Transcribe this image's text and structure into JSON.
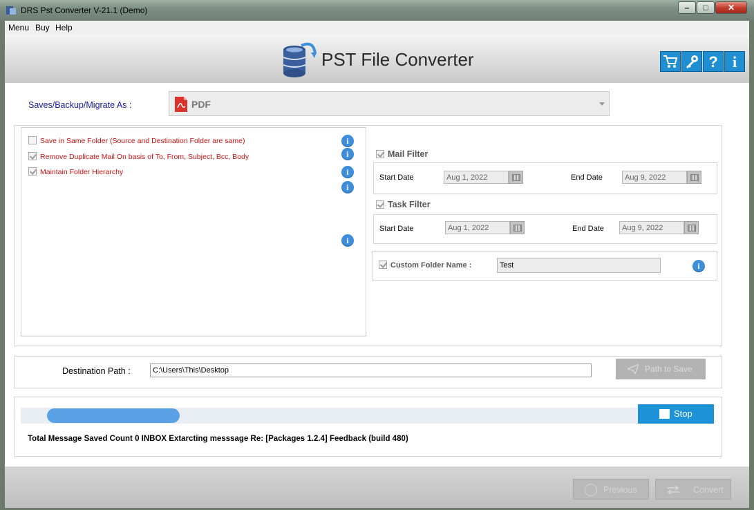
{
  "window": {
    "title": "DRS Pst Converter V-21.1 (Demo)",
    "minimize": "–",
    "maximize": "□",
    "close": "✕"
  },
  "menu": {
    "items": [
      "Menu",
      "Buy",
      "Help"
    ]
  },
  "header": {
    "app_title": "PST File Converter",
    "buttons": [
      "cart-icon",
      "key-icon",
      "help-icon",
      "info-icon"
    ],
    "accent": "#1f8fd2"
  },
  "saves": {
    "label": "Saves/Backup/Migrate As :",
    "format": "PDF"
  },
  "options": [
    {
      "label": "Save in Same Folder (Source and Destination Folder are same)",
      "checked": false
    },
    {
      "label": "Remove Duplicate Mail On basis of To, From, Subject, Bcc, Body",
      "checked": true
    },
    {
      "label": "Maintain Folder Hierarchy",
      "checked": true
    }
  ],
  "info_glyph": "i",
  "mail_filter": {
    "label": "Mail Filter",
    "start_label": "Start Date",
    "start": "Aug 1, 2022",
    "end_label": "End Date",
    "end": "Aug 9, 2022"
  },
  "task_filter": {
    "label": "Task Filter",
    "start_label": "Start Date",
    "start": "Aug 1, 2022",
    "end_label": "End Date",
    "end": "Aug 9, 2022"
  },
  "custom_folder": {
    "label": "Custom Folder Name :",
    "value": "Test"
  },
  "destination": {
    "label": "Destination Path :",
    "value": "C:\\Users\\This\\Desktop",
    "button": "Path to Save"
  },
  "progress": {
    "fraction": 0.224,
    "stop_label": "Stop"
  },
  "status": "Total Message Saved Count 0 INBOX Extarcting messsage Re: [Packages 1.2.4] Feedback (build 480)",
  "footer": {
    "previous": "Previous",
    "convert": "Convert"
  }
}
